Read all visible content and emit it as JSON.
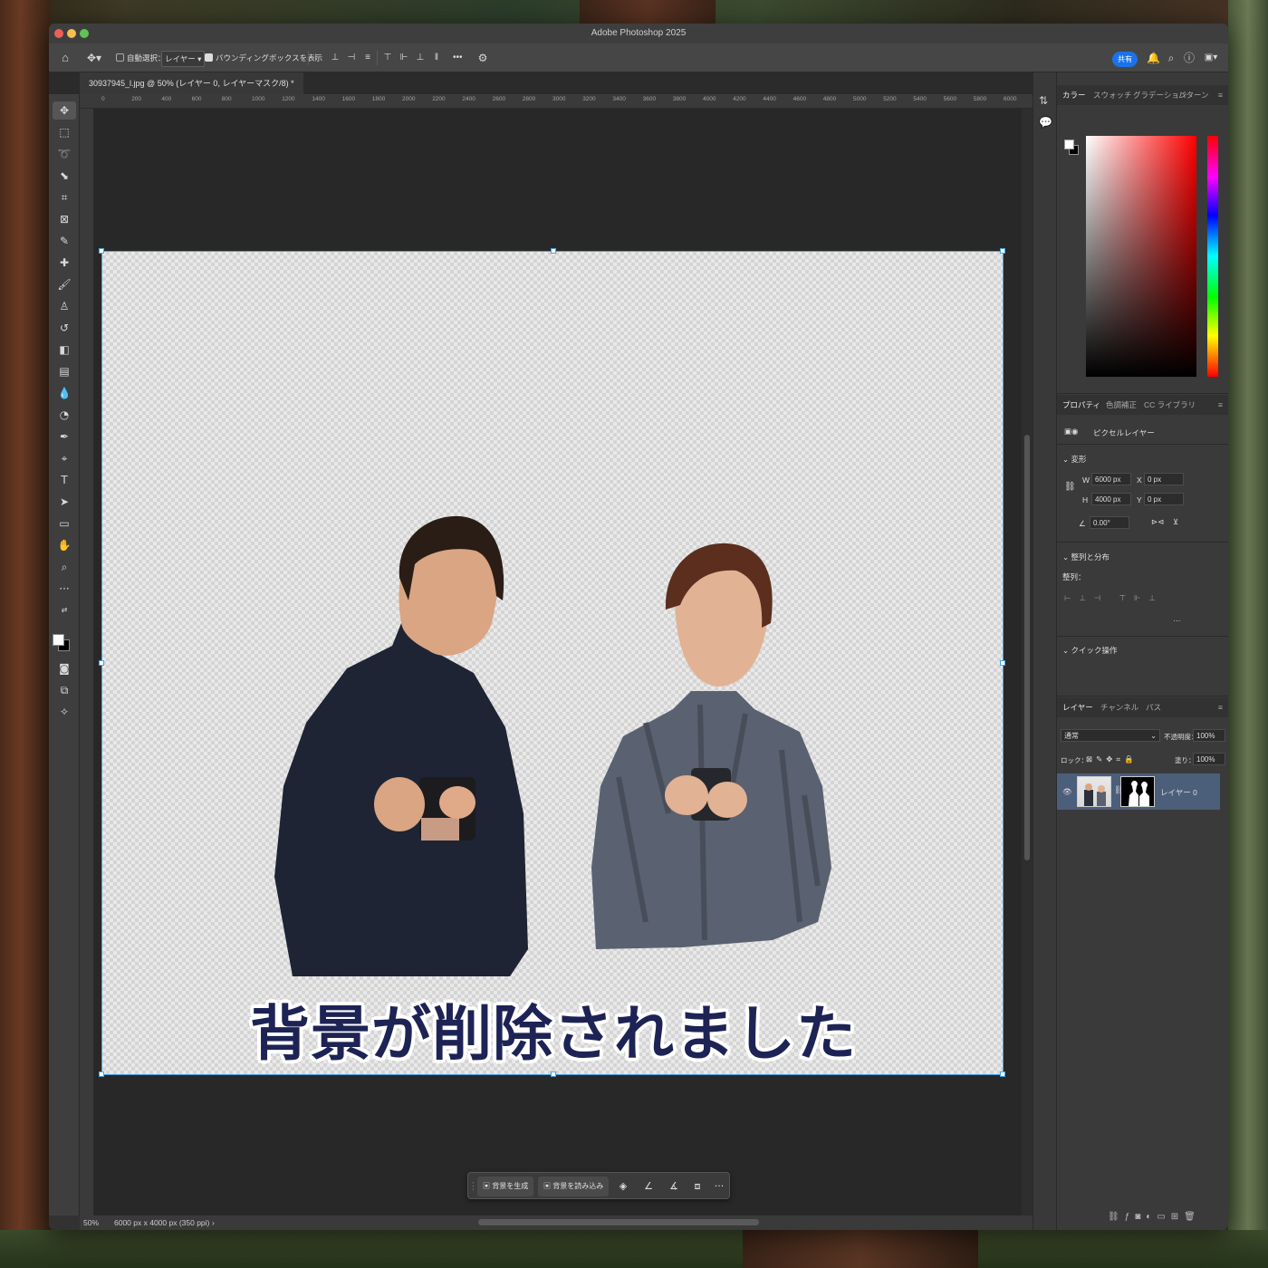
{
  "window": {
    "title": "Adobe Photoshop 2025"
  },
  "options_bar": {
    "auto_select_label": "自動選択：",
    "auto_select_value": "レイヤー",
    "bounding_box_label": "バウンディングボックスを表示",
    "more_label": "•••",
    "share_label": "共有"
  },
  "document": {
    "tab_title": "30937945_l.jpg @ 50% (レイヤー 0, レイヤーマスク/8) *",
    "caption": "背景が削除されました"
  },
  "rulers": {
    "h_ticks": [
      "0",
      "200",
      "400",
      "600",
      "800",
      "1000",
      "1200",
      "1400",
      "1600",
      "1800",
      "2000",
      "2200",
      "2400",
      "2600",
      "2800",
      "3000",
      "3200",
      "3400",
      "3600",
      "3800",
      "4000",
      "4200",
      "4400",
      "4600",
      "4800",
      "5000",
      "5200",
      "5400",
      "5600",
      "5800",
      "6000"
    ]
  },
  "context_bar": {
    "generate_bg_label": "背景を生成",
    "import_bg_label": "背景を読み込み",
    "more_label": "···"
  },
  "status": {
    "zoom": "50%",
    "doc_info": "6000 px x 4000 px (350 ppi)"
  },
  "color_panel": {
    "tabs": [
      "カラー",
      "スウォッチ",
      "グラデーション",
      "パターン"
    ],
    "fg_color": "#ffffff",
    "bg_color": "#000000"
  },
  "properties_panel": {
    "tabs": [
      "プロパティ",
      "色調補正",
      "CC ライブラリ"
    ],
    "layer_kind": "ピクセルレイヤー",
    "transform_label": "変形",
    "w_label": "W",
    "w_value": "6000 px",
    "h_label": "H",
    "h_value": "4000 px",
    "x_label": "X",
    "x_value": "0 px",
    "y_label": "Y",
    "y_value": "0 px",
    "angle_value": "0.00°",
    "align_section": "整列と分布",
    "align_label": "整列：",
    "quick_actions": "クイック操作"
  },
  "layers_panel": {
    "tabs": [
      "レイヤー",
      "チャンネル",
      "パス"
    ],
    "blend_mode": "通常",
    "opacity_label": "不透明度：",
    "opacity_value": "100%",
    "lock_label": "ロック：",
    "fill_label": "塗り：",
    "fill_value": "100%",
    "layers": [
      {
        "name": "レイヤー 0",
        "visible": true
      }
    ]
  }
}
